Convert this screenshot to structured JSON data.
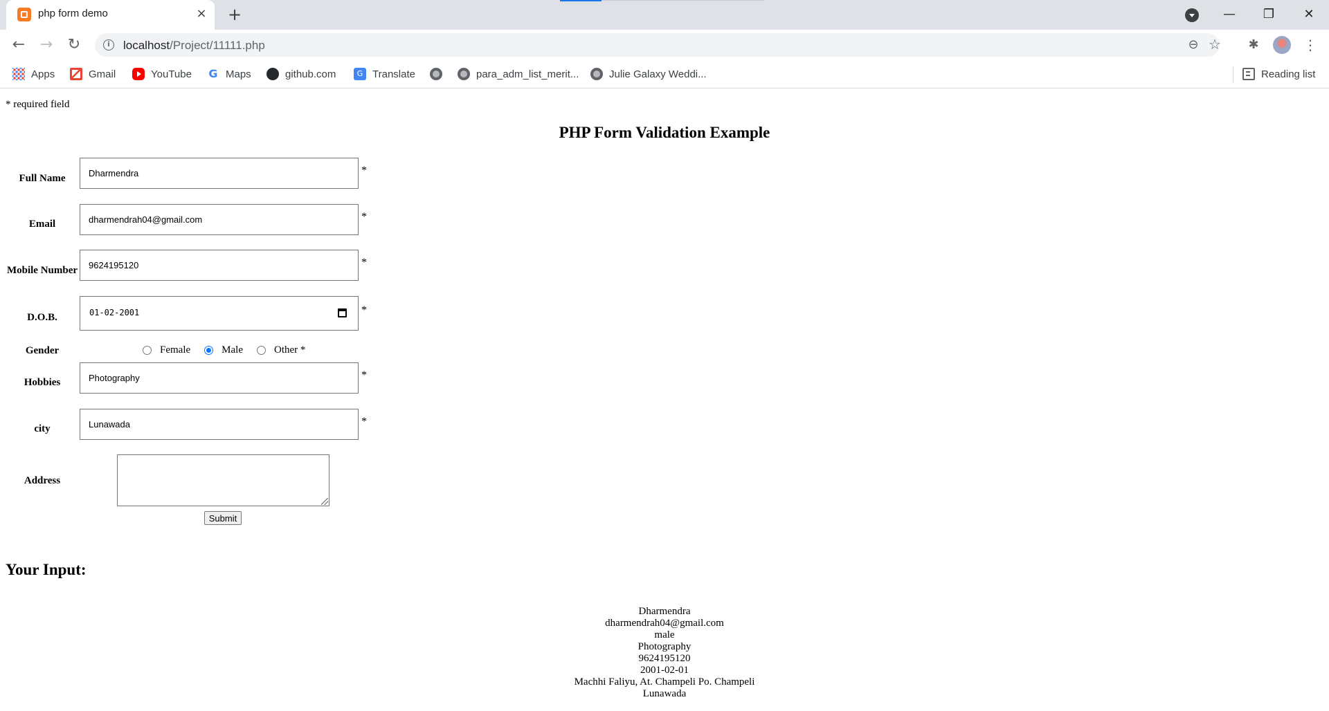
{
  "browser": {
    "tab_title": "php form demo",
    "url_host": "localhost",
    "url_path": "/Project/11111.php",
    "bookmarks": [
      {
        "label": "Apps",
        "icon": "apps-grid-icon"
      },
      {
        "label": "Gmail",
        "icon": "gmail-icon"
      },
      {
        "label": "YouTube",
        "icon": "youtube-icon"
      },
      {
        "label": "Maps",
        "icon": "google-maps-icon"
      },
      {
        "label": "github.com",
        "icon": "github-icon"
      },
      {
        "label": "Translate",
        "icon": "translate-icon"
      },
      {
        "label": "",
        "icon": "globe-icon"
      },
      {
        "label": "para_adm_list_merit...",
        "icon": "globe-icon"
      },
      {
        "label": "Julie Galaxy Weddi...",
        "icon": "globe-icon"
      }
    ],
    "reading_list": "Reading list",
    "colors": {
      "tabstrip": "#dee1e6",
      "accent": "#1a73e8"
    }
  },
  "page": {
    "required_note": "* required field",
    "heading": "PHP Form Validation Example",
    "required_mark": "*",
    "fields": {
      "full_name": {
        "label": "Full Name",
        "value": "Dharmendra"
      },
      "email": {
        "label": "Email",
        "value": "dharmendrah04@gmail.com"
      },
      "mobile": {
        "label": "Mobile Number",
        "value": "9624195120"
      },
      "dob": {
        "label": "D.O.B.",
        "value": "01-02-2001"
      },
      "gender": {
        "label": "Gender",
        "options": [
          "Female",
          "Male",
          "Other *"
        ],
        "selected": "Male"
      },
      "hobbies": {
        "label": "Hobbies",
        "value": "Photography"
      },
      "city": {
        "label": "city",
        "value": "Lunawada"
      },
      "address": {
        "label": "Address",
        "value": ""
      }
    },
    "submit_label": "Submit",
    "output_heading": "Your Input:",
    "output_lines": [
      "Dharmendra",
      "dharmendrah04@gmail.com",
      "male",
      "Photography",
      "9624195120",
      "2001-02-01",
      "Machhi Faliyu, At. Champeli Po. Champeli",
      "Lunawada"
    ],
    "colors": {
      "radio_checked": "#0075ff",
      "input_border": "#767676"
    }
  }
}
